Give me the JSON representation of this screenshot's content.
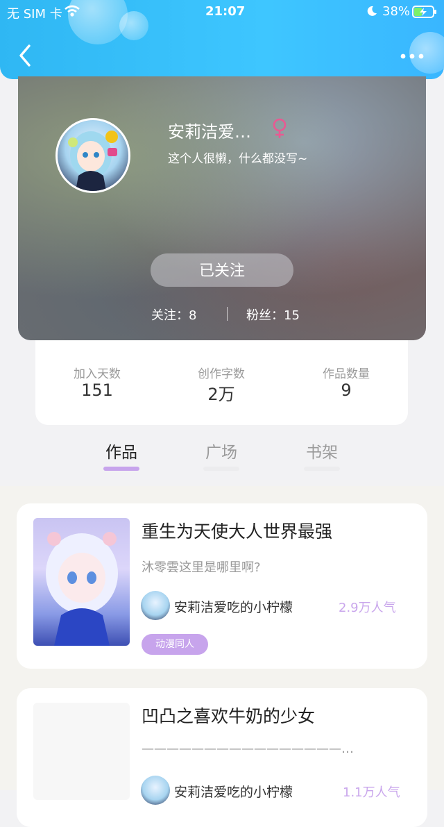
{
  "status_bar": {
    "carrier": "无 SIM 卡",
    "time": "21:07",
    "battery": "38%"
  },
  "profile": {
    "nickname": "安莉洁爱…",
    "gender_icon": "female-icon",
    "bio": "这个人很懒，什么都没写~",
    "follow_button": "已关注",
    "following_label": "关注：8",
    "fans_label": "粉丝：15"
  },
  "stats": [
    {
      "label": "加入天数",
      "value": "151"
    },
    {
      "label": "创作字数",
      "value": "2万"
    },
    {
      "label": "作品数量",
      "value": "9"
    }
  ],
  "tabs": [
    {
      "label": "作品",
      "active": true
    },
    {
      "label": "广场",
      "active": false
    },
    {
      "label": "书架",
      "active": false
    }
  ],
  "works": [
    {
      "title": "重生为天使大人世界最强",
      "desc": "沐零雲这里是哪里啊?",
      "author": "安莉洁爱吃的小柠檬",
      "popularity": "2.9万人气",
      "tag": "动漫同人"
    },
    {
      "title": "凹凸之喜欢牛奶的少女",
      "desc": "————————————————…",
      "author": "安莉洁爱吃的小柠檬",
      "popularity": "1.1万人气"
    }
  ],
  "colors": {
    "accent": "#c7a4ec",
    "header": "#2fb7f3"
  }
}
